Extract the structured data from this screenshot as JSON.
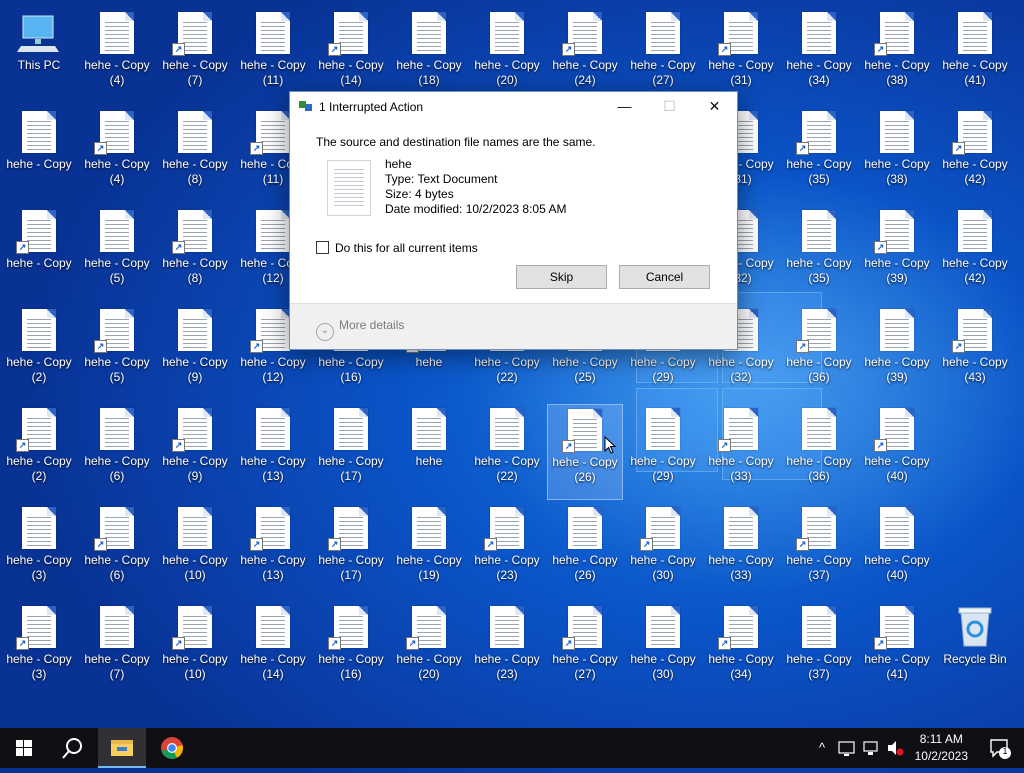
{
  "desktop": {
    "icon_column_x": [
      0,
      78,
      156,
      234,
      312,
      390,
      468,
      546,
      624,
      702,
      780,
      858,
      936
    ],
    "icon_row_y": [
      8,
      107,
      206,
      305,
      404,
      503,
      602
    ],
    "icons": [
      {
        "label": "This PC",
        "type": "pc",
        "col": 0,
        "row": 0
      },
      {
        "label": "hehe - Copy (4)",
        "col": 1,
        "row": 0
      },
      {
        "label": "hehe - Copy (7)",
        "col": 2,
        "row": 0,
        "shortcut": true
      },
      {
        "label": "hehe - Copy (11)",
        "col": 3,
        "row": 0
      },
      {
        "label": "hehe - Copy (14)",
        "col": 4,
        "row": 0,
        "shortcut": true
      },
      {
        "label": "hehe - Copy (18)",
        "col": 5,
        "row": 0
      },
      {
        "label": "hehe - Copy (20)",
        "col": 6,
        "row": 0
      },
      {
        "label": "hehe - Copy (24)",
        "col": 7,
        "row": 0,
        "shortcut": true
      },
      {
        "label": "hehe - Copy (27)",
        "col": 8,
        "row": 0
      },
      {
        "label": "hehe - Copy (31)",
        "col": 9,
        "row": 0,
        "shortcut": true
      },
      {
        "label": "hehe - Copy (34)",
        "col": 10,
        "row": 0
      },
      {
        "label": "hehe - Copy (38)",
        "col": 11,
        "row": 0,
        "shortcut": true
      },
      {
        "label": "hehe - Copy (41)",
        "col": 12,
        "row": 0
      },
      {
        "label": "hehe - Copy",
        "col": 0,
        "row": 1
      },
      {
        "label": "hehe - Copy (4)",
        "col": 1,
        "row": 1,
        "shortcut": true
      },
      {
        "label": "hehe - Copy (8)",
        "col": 2,
        "row": 1
      },
      {
        "label": "hehe - Copy (11)",
        "col": 3,
        "row": 1,
        "shortcut": true
      },
      {
        "label": "hehe - Copy (31)",
        "col": 9,
        "row": 1
      },
      {
        "label": "hehe - Copy (35)",
        "col": 10,
        "row": 1,
        "shortcut": true
      },
      {
        "label": "hehe - Copy (38)",
        "col": 11,
        "row": 1
      },
      {
        "label": "hehe - Copy (42)",
        "col": 12,
        "row": 1,
        "shortcut": true
      },
      {
        "label": "hehe - Copy",
        "col": 0,
        "row": 2,
        "shortcut": true
      },
      {
        "label": "hehe - Copy (5)",
        "col": 1,
        "row": 2
      },
      {
        "label": "hehe - Copy (8)",
        "col": 2,
        "row": 2,
        "shortcut": true
      },
      {
        "label": "hehe - Copy (12)",
        "col": 3,
        "row": 2
      },
      {
        "label": "hehe - Copy (32)",
        "col": 9,
        "row": 2,
        "shortcut": true
      },
      {
        "label": "hehe - Copy (35)",
        "col": 10,
        "row": 2
      },
      {
        "label": "hehe - Copy (39)",
        "col": 11,
        "row": 2,
        "shortcut": true
      },
      {
        "label": "hehe - Copy (42)",
        "col": 12,
        "row": 2
      },
      {
        "label": "hehe - Copy (2)",
        "col": 0,
        "row": 3
      },
      {
        "label": "hehe - Copy (5)",
        "col": 1,
        "row": 3,
        "shortcut": true
      },
      {
        "label": "hehe - Copy (9)",
        "col": 2,
        "row": 3
      },
      {
        "label": "hehe - Copy (12)",
        "col": 3,
        "row": 3,
        "shortcut": true
      },
      {
        "label": "hehe - Copy (16)",
        "col": 4,
        "row": 3
      },
      {
        "label": "hehe",
        "col": 5,
        "row": 3,
        "shortcut": true
      },
      {
        "label": "hehe - Copy (22)",
        "col": 6,
        "row": 3
      },
      {
        "label": "hehe - Copy (25)",
        "col": 7,
        "row": 3
      },
      {
        "label": "hehe - Copy (29)",
        "col": 8,
        "row": 3
      },
      {
        "label": "hehe - Copy (32)",
        "col": 9,
        "row": 3
      },
      {
        "label": "hehe - Copy (36)",
        "col": 10,
        "row": 3,
        "shortcut": true
      },
      {
        "label": "hehe - Copy (39)",
        "col": 11,
        "row": 3
      },
      {
        "label": "hehe - Copy (43)",
        "col": 12,
        "row": 3,
        "shortcut": true
      },
      {
        "label": "hehe - Copy (2)",
        "col": 0,
        "row": 4,
        "shortcut": true
      },
      {
        "label": "hehe - Copy (6)",
        "col": 1,
        "row": 4
      },
      {
        "label": "hehe - Copy (9)",
        "col": 2,
        "row": 4,
        "shortcut": true
      },
      {
        "label": "hehe - Copy (13)",
        "col": 3,
        "row": 4
      },
      {
        "label": "hehe - Copy (17)",
        "col": 4,
        "row": 4
      },
      {
        "label": "hehe",
        "col": 5,
        "row": 4
      },
      {
        "label": "hehe - Copy (22)",
        "col": 6,
        "row": 4
      },
      {
        "label": "hehe - Copy (26)",
        "col": 7,
        "row": 4,
        "shortcut": true,
        "selected": true
      },
      {
        "label": "hehe - Copy (29)",
        "col": 8,
        "row": 4
      },
      {
        "label": "hehe - Copy (33)",
        "col": 9,
        "row": 4,
        "shortcut": true
      },
      {
        "label": "hehe - Copy (36)",
        "col": 10,
        "row": 4
      },
      {
        "label": "hehe - Copy (40)",
        "col": 11,
        "row": 4,
        "shortcut": true
      },
      {
        "label": "hehe - Copy (3)",
        "col": 0,
        "row": 5
      },
      {
        "label": "hehe - Copy (6)",
        "col": 1,
        "row": 5,
        "shortcut": true
      },
      {
        "label": "hehe - Copy (10)",
        "col": 2,
        "row": 5
      },
      {
        "label": "hehe - Copy (13)",
        "col": 3,
        "row": 5,
        "shortcut": true
      },
      {
        "label": "hehe - Copy (17)",
        "col": 4,
        "row": 5,
        "shortcut": true
      },
      {
        "label": "hehe - Copy (19)",
        "col": 5,
        "row": 5
      },
      {
        "label": "hehe - Copy (23)",
        "col": 6,
        "row": 5,
        "shortcut": true
      },
      {
        "label": "hehe - Copy (26)",
        "col": 7,
        "row": 5
      },
      {
        "label": "hehe - Copy (30)",
        "col": 8,
        "row": 5,
        "shortcut": true
      },
      {
        "label": "hehe - Copy (33)",
        "col": 9,
        "row": 5
      },
      {
        "label": "hehe - Copy (37)",
        "col": 10,
        "row": 5,
        "shortcut": true
      },
      {
        "label": "hehe - Copy (40)",
        "col": 11,
        "row": 5
      },
      {
        "label": "hehe - Copy (3)",
        "col": 0,
        "row": 6,
        "shortcut": true
      },
      {
        "label": "hehe - Copy (7)",
        "col": 1,
        "row": 6
      },
      {
        "label": "hehe - Copy (10)",
        "col": 2,
        "row": 6,
        "shortcut": true
      },
      {
        "label": "hehe - Copy (14)",
        "col": 3,
        "row": 6
      },
      {
        "label": "hehe - Copy (16)",
        "col": 4,
        "row": 6,
        "shortcut": true
      },
      {
        "label": "hehe - Copy (20)",
        "col": 5,
        "row": 6,
        "shortcut": true
      },
      {
        "label": "hehe - Copy (23)",
        "col": 6,
        "row": 6
      },
      {
        "label": "hehe - Copy (27)",
        "col": 7,
        "row": 6,
        "shortcut": true
      },
      {
        "label": "hehe - Copy (30)",
        "col": 8,
        "row": 6
      },
      {
        "label": "hehe - Copy (34)",
        "col": 9,
        "row": 6,
        "shortcut": true
      },
      {
        "label": "hehe - Copy (37)",
        "col": 10,
        "row": 6
      },
      {
        "label": "hehe - Copy (41)",
        "col": 11,
        "row": 6,
        "shortcut": true
      },
      {
        "label": "Recycle Bin",
        "type": "recycle",
        "col": 12,
        "row": 6
      }
    ]
  },
  "dialog": {
    "title": "1 Interrupted Action",
    "message": "The source and destination file names are the same.",
    "file": {
      "name": "hehe",
      "type": "Type: Text Document",
      "size": "Size: 4 bytes",
      "date": "Date modified: 10/2/2023 8:05 AM"
    },
    "checkbox_label": "Do this for all current items",
    "skip_label": "Skip",
    "cancel_label": "Cancel",
    "more_details_label": "More details",
    "minimize_glyph": "—",
    "maximize_glyph": "☐",
    "close_glyph": "✕"
  },
  "taskbar": {
    "time": "8:11 AM",
    "date": "10/2/2023",
    "notification_count": "1",
    "tray_chevron": "^"
  },
  "colors": {
    "accent": "#0078d7",
    "taskbar": "#0f0f14",
    "desktop": "#0a54c8"
  }
}
